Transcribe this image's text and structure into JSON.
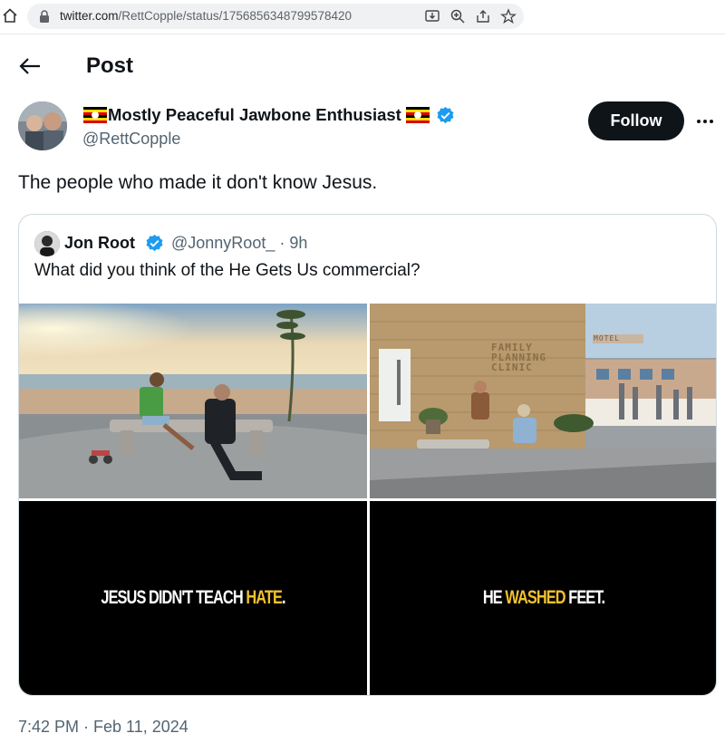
{
  "browser": {
    "url_domain": "twitter.com",
    "url_path": "/RettCopple/status/1756856348799578420",
    "icons": [
      "home-icon",
      "lock-icon",
      "install-icon",
      "zoom-icon",
      "share-icon",
      "bookmark-star-icon"
    ]
  },
  "header": {
    "title": "Post",
    "back_icon": "arrow-left-icon"
  },
  "tweet": {
    "author_name": "Mostly Peaceful Jawbone Enthusiast",
    "author_handle": "@RettCopple",
    "flag_icon": "uganda-flag-icon",
    "follow_label": "Follow",
    "text": "The people who made it don't know Jesus.",
    "timestamp": "7:42 PM · Feb 11, 2024"
  },
  "quote": {
    "author_name": "Jon Root",
    "author_handle": "@JonnyRoot_ · 9h",
    "text": "What did you think of the He Gets Us commercial?",
    "images": {
      "clinic_sign": "FAMILY\nPLANNING\nCLINIC",
      "motel_sign": "MOTEL"
    },
    "captions": [
      {
        "before": "JESUS DIDN'T TEACH ",
        "highlight": "HATE",
        "after": "."
      },
      {
        "before": "HE ",
        "highlight": "WASHED",
        "after": " FEET."
      }
    ]
  },
  "colors": {
    "text_primary": "#0f1419",
    "text_secondary": "#536471",
    "verified_blue": "#1d9bf0",
    "caption_highlight": "#f2c12e",
    "follow_bg": "#0f1419"
  }
}
